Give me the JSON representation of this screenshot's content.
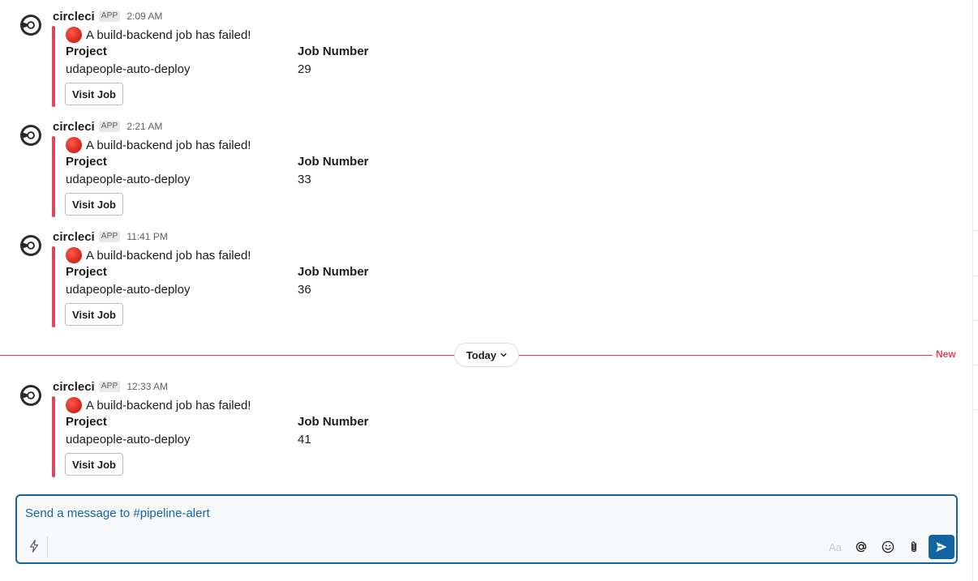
{
  "messages": [
    {
      "sender": "circleci",
      "badge": "APP",
      "time": "2:09 AM",
      "alert": "A build-backend job has failed!",
      "project_label": "Project",
      "project_value": "udapeople-auto-deploy",
      "job_label": "Job Number",
      "job_value": "29",
      "button": "Visit Job"
    },
    {
      "sender": "circleci",
      "badge": "APP",
      "time": "2:21 AM",
      "alert": "A build-backend job has failed!",
      "project_label": "Project",
      "project_value": "udapeople-auto-deploy",
      "job_label": "Job Number",
      "job_value": "33",
      "button": "Visit Job"
    },
    {
      "sender": "circleci",
      "badge": "APP",
      "time": "11:41 PM",
      "alert": "A build-backend job has failed!",
      "project_label": "Project",
      "project_value": "udapeople-auto-deploy",
      "job_label": "Job Number",
      "job_value": "36",
      "button": "Visit Job"
    },
    {
      "sender": "circleci",
      "badge": "APP",
      "time": "12:33 AM",
      "alert": "A build-backend job has failed!",
      "project_label": "Project",
      "project_value": "udapeople-auto-deploy",
      "job_label": "Job Number",
      "job_value": "41",
      "button": "Visit Job"
    }
  ],
  "divider": {
    "label": "Today",
    "new_label": "New"
  },
  "composer": {
    "placeholder": "Send a message to #pipeline-alert",
    "format_label": "Aa"
  },
  "icons": {
    "avatar": "circleci-logo-icon",
    "alert": "red-circle-icon",
    "shortcuts": "lightning-icon",
    "mention": "at-sign-icon",
    "emoji": "smiley-icon",
    "attach": "paperclip-icon",
    "send": "send-icon"
  },
  "colors": {
    "accent": "#1264a3",
    "alert_bar": "#e0465a",
    "new_divider": "#e0465a"
  }
}
